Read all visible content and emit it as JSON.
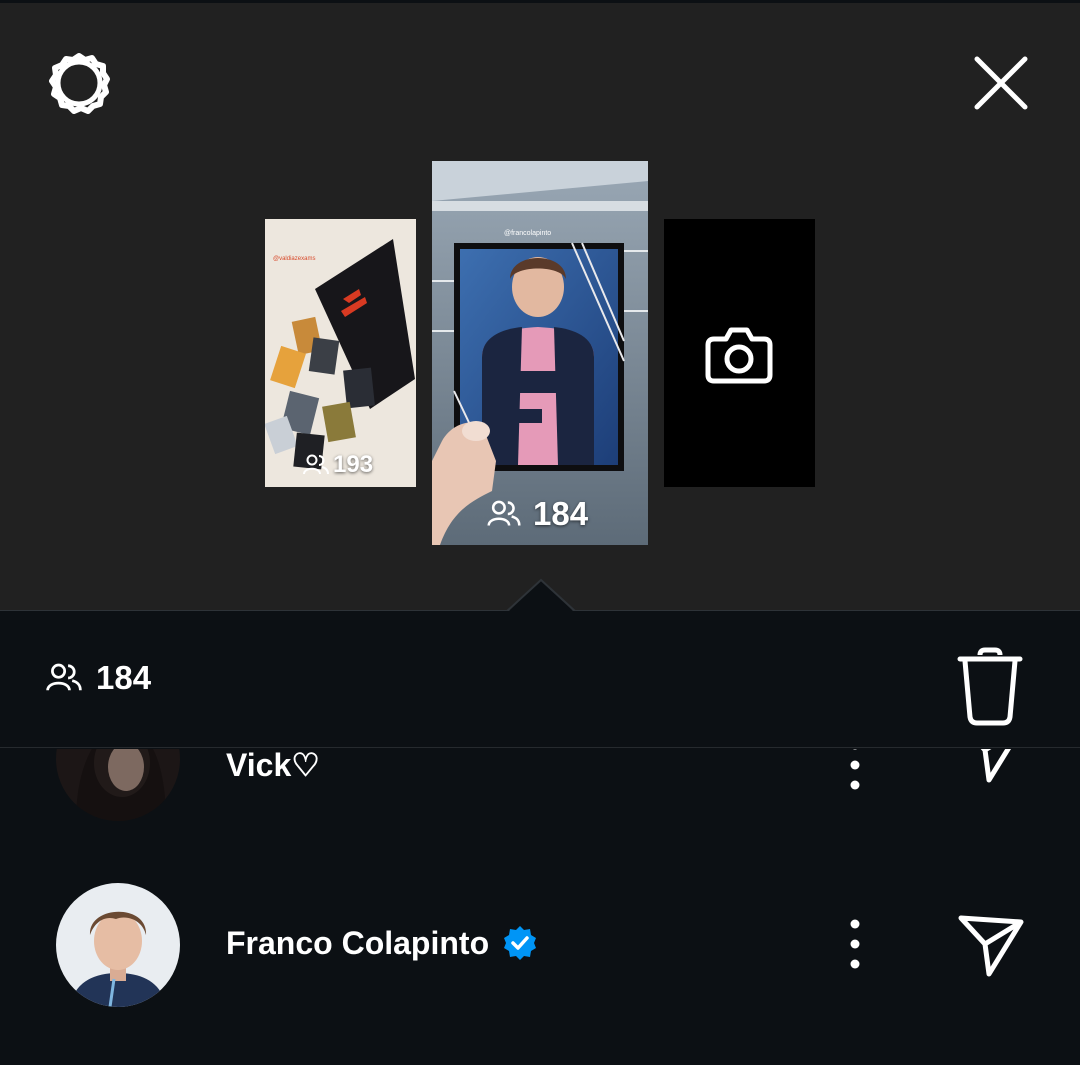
{
  "header": {
    "settings_icon": "gear-icon",
    "close_icon": "close-icon"
  },
  "stories": [
    {
      "tag": "@valdiazexams",
      "viewers": "193"
    },
    {
      "tag": "@francolapinto",
      "viewers": "184"
    },
    {
      "type": "camera",
      "icon": "camera-icon"
    }
  ],
  "panel": {
    "viewer_count": "184",
    "delete_icon": "trash-icon"
  },
  "viewers": [
    {
      "name": "Vick♡",
      "verified": false
    },
    {
      "name": "Franco Colapinto",
      "verified": true
    }
  ],
  "colors": {
    "background": "#212121",
    "panel": "#0c1014",
    "verified_badge": "#0095f6"
  }
}
